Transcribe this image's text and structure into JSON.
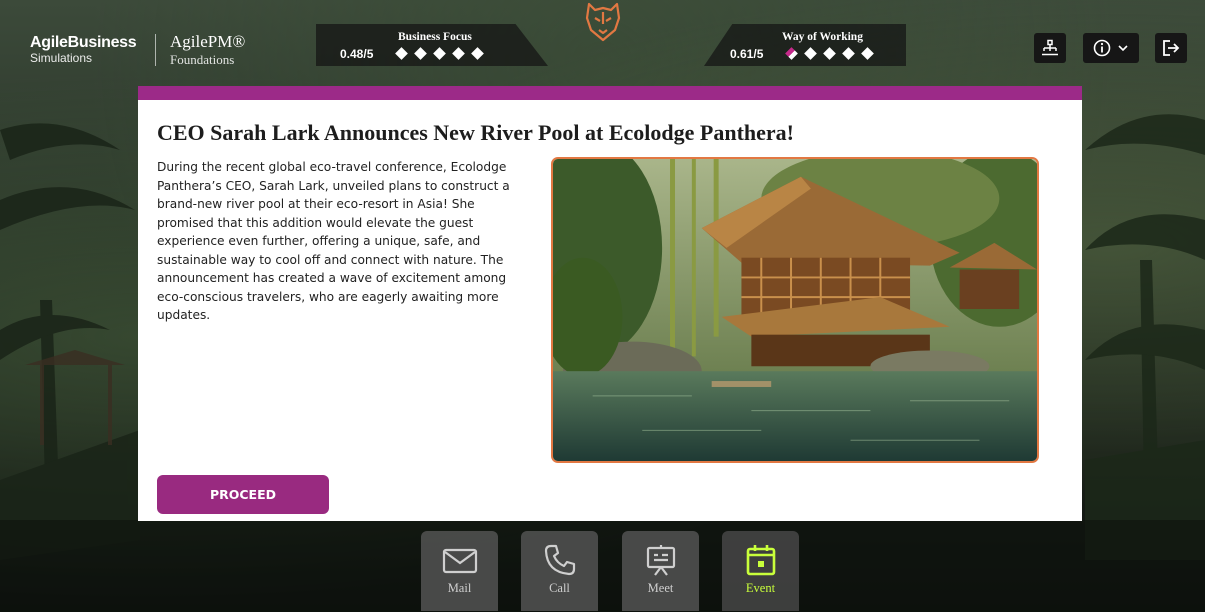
{
  "brand": {
    "primary_line1": "AgileBusiness",
    "primary_line2": "Simulations",
    "secondary_line1": "AgilePM®",
    "secondary_line2": "Foundations"
  },
  "scores": {
    "business_focus": {
      "title": "Business Focus",
      "value": "0.48/5",
      "level": 0.48,
      "max": 5
    },
    "way_of_working": {
      "title": "Way of Working",
      "value": "0.61/5",
      "level": 0.61,
      "max": 5
    }
  },
  "toolbar": {
    "icons": [
      "org-chart-icon",
      "info-icon",
      "chevron-down-icon",
      "logout-icon"
    ]
  },
  "event": {
    "title": "CEO Sarah Lark Announces New River Pool at Ecolodge Panthera!",
    "body": "During the recent global eco-travel conference, Ecolodge Panthera’s CEO, Sarah Lark, unveiled plans to construct a brand-new river pool at their eco-resort in Asia! She promised that this addition would elevate the guest experience even further, offering a unique, safe, and sustainable way to cool off and connect with nature. The announcement has created a wave of excitement among eco-conscious travelers, who are eagerly awaiting more updates.",
    "proceed_label": "PROCEED"
  },
  "dock": {
    "items": [
      {
        "label": "Mail",
        "icon": "mail-icon",
        "active": false
      },
      {
        "label": "Call",
        "icon": "phone-icon",
        "active": false
      },
      {
        "label": "Meet",
        "icon": "presentation-icon",
        "active": false
      },
      {
        "label": "Event",
        "icon": "calendar-icon",
        "active": true
      }
    ]
  },
  "colors": {
    "accent": "#9c2a88",
    "photo_border": "#e27842",
    "active_dock": "#c9ff3b"
  }
}
